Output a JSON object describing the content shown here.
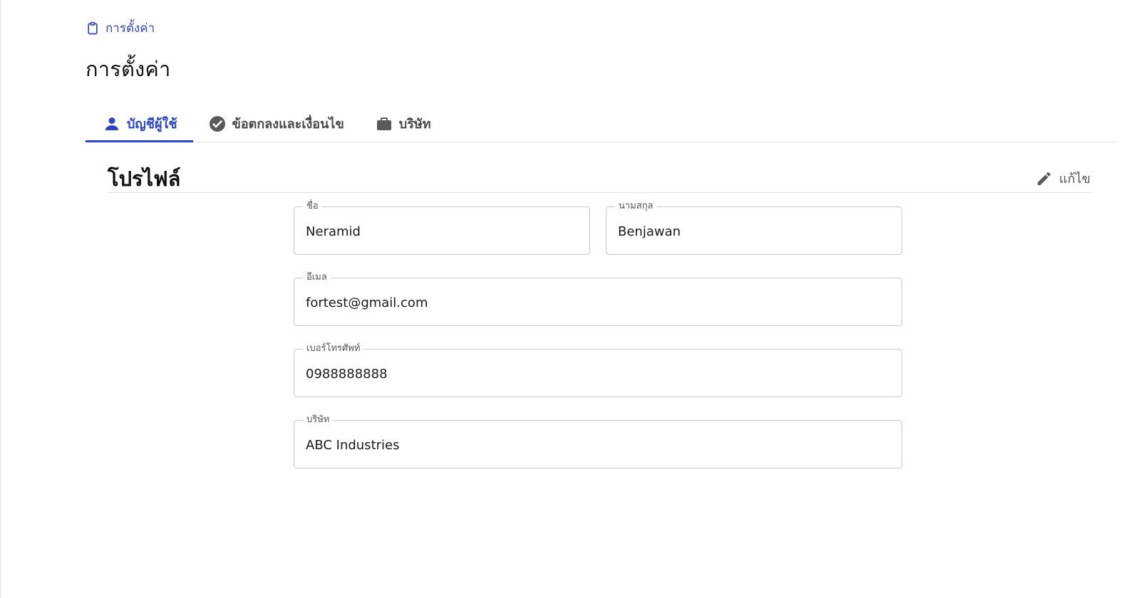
{
  "breadcrumb": {
    "label": "การตั้งค่า",
    "icon": "clipboard-icon"
  },
  "page": {
    "title": "การตั้งค่า"
  },
  "tabs": [
    {
      "label": "บัญชีผู้ใช้",
      "icon": "person-icon",
      "active": true
    },
    {
      "label": "ข้อตกลงและเงื่อนไข",
      "icon": "check-circle-icon",
      "active": false
    },
    {
      "label": "บริษัท",
      "icon": "briefcase-icon",
      "active": false
    }
  ],
  "profile": {
    "title": "โปรไฟล์",
    "edit_label": "แก้ไข",
    "fields": {
      "first_name": {
        "label": "ชื่อ",
        "value": "Neramid"
      },
      "last_name": {
        "label": "นามสกุล",
        "value": "Benjawan"
      },
      "email": {
        "label": "อีเมล",
        "value": "fortest@gmail.com"
      },
      "phone": {
        "label": "เบอร์โทรศัพท์",
        "value": "0988888888"
      },
      "company": {
        "label": "บริษัท",
        "value": "ABC Industries"
      }
    }
  },
  "colors": {
    "accent": "#2b45c9",
    "text": "#111111",
    "muted": "#555555",
    "border": "#c7c7c7"
  }
}
